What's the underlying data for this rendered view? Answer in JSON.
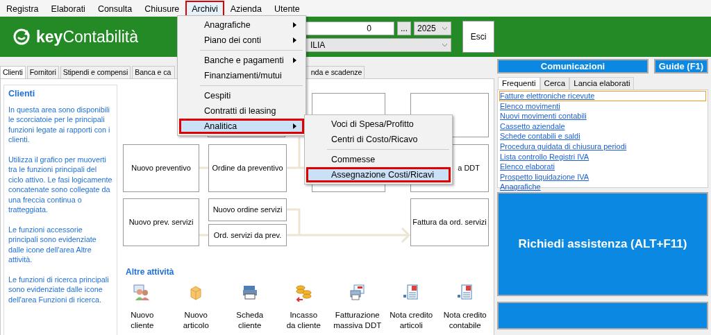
{
  "menubar": [
    {
      "label": "Registra",
      "selected": false,
      "outlined": false
    },
    {
      "label": "Elaborati",
      "selected": false,
      "outlined": false
    },
    {
      "label": "Consulta",
      "selected": false,
      "outlined": false
    },
    {
      "label": "Chiusure",
      "selected": false,
      "outlined": false
    },
    {
      "label": "Archivi",
      "selected": true,
      "outlined": true
    },
    {
      "label": "Azienda",
      "selected": false,
      "outlined": false
    },
    {
      "label": "Utente",
      "selected": false,
      "outlined": false
    }
  ],
  "header": {
    "logo": "**key**Contabilità",
    "company_code": "0",
    "browse_button": "...",
    "year": "2025",
    "company_name": "ILIA",
    "exit_button": "Esci"
  },
  "tabs": [
    {
      "label": "Clienti",
      "selected": true
    },
    {
      "label": "Fornitori",
      "selected": false
    },
    {
      "label": "Stipendi e compensi",
      "selected": false
    },
    {
      "label": "Banca e ca",
      "selected": false
    },
    {
      "label": "nda e scadenze",
      "selected": false
    }
  ],
  "info_panel": {
    "title": "Clienti",
    "paragraphs": [
      "In questa area sono disponibili le scorciatoie per le principali funzioni legate ai rapporti con i clienti.",
      "Utilizza il grafico per muoverti tra le funzioni principali del ciclo attivo. Le fasi logicamente concatenate sono collegate da una freccia continua o tratteggiata.",
      "Le funzioni accessorie principali sono evidenziate dalle icone dell'area Altre attività.",
      "Le funzioni di ricerca principali sono evidenziate dalle icone dell'area Funzioni di ricerca."
    ]
  },
  "diagram": {
    "nodes": [
      {
        "label": "Nuovo preventivo"
      },
      {
        "label": "Ordine da preventivo"
      },
      {
        "label": "a DDT"
      },
      {
        "label": "Nuovo prev. servizi"
      },
      {
        "label": "Nuovo ordine servizi"
      },
      {
        "label": "Ord. servizi da prev."
      },
      {
        "label": "Fattura da ord. servizi"
      }
    ]
  },
  "other_activities": {
    "title": "Altre attività",
    "items": [
      {
        "label": "Nuovo\ncliente"
      },
      {
        "label": "Nuovo\narticolo"
      },
      {
        "label": "Scheda\ncliente"
      },
      {
        "label": "Incasso\nda cliente"
      },
      {
        "label": "Fatturazione\nmassiva DDT"
      },
      {
        "label": "Nota credito\narticoli"
      },
      {
        "label": "Nota credito\ncontabile"
      }
    ]
  },
  "right_panel": {
    "communications_button": "Comunicazioni",
    "guide_button": "Guide (F1)",
    "tabs": [
      {
        "label": "Frequenti",
        "selected": true
      },
      {
        "label": "Cerca",
        "selected": false
      },
      {
        "label": "Lancia elaborati",
        "selected": false
      }
    ],
    "links": [
      {
        "label": "Fatture elettroniche ricevute",
        "focused": true
      },
      {
        "label": "Elenco movimenti",
        "focused": false
      },
      {
        "label": "Nuovi movimenti contabili",
        "focused": false
      },
      {
        "label": "Cassetto aziendale",
        "focused": false
      },
      {
        "label": "Schede contabili e saldi",
        "focused": false
      },
      {
        "label": "Procedura guidata di chiusura periodi",
        "focused": false
      },
      {
        "label": "Lista controllo Registri IVA",
        "focused": false
      },
      {
        "label": "Elenco elaborati",
        "focused": false
      },
      {
        "label": "Prospetto liquidazione IVA",
        "focused": false
      },
      {
        "label": "Anagrafiche",
        "focused": false
      }
    ],
    "assistance_button": "Richiedi assistenza  (ALT+F11)"
  },
  "menu": {
    "items": [
      {
        "kind": "item",
        "label": "Anagrafiche",
        "submenu": true,
        "selected": false,
        "outlined": false
      },
      {
        "kind": "item",
        "label": "Piano dei conti",
        "submenu": true,
        "selected": false,
        "outlined": false
      },
      {
        "kind": "separator"
      },
      {
        "kind": "item",
        "label": "Banche e pagamenti",
        "submenu": true,
        "selected": false,
        "outlined": false
      },
      {
        "kind": "item",
        "label": "Finanziamenti/mutui",
        "submenu": false,
        "selected": false,
        "outlined": false
      },
      {
        "kind": "separator"
      },
      {
        "kind": "item",
        "label": "Cespiti",
        "submenu": false,
        "selected": false,
        "outlined": false
      },
      {
        "kind": "item",
        "label": "Contratti di leasing",
        "submenu": false,
        "selected": false,
        "outlined": false
      },
      {
        "kind": "item",
        "label": "Analitica",
        "submenu": true,
        "selected": true,
        "outlined": true
      }
    ]
  },
  "submenu": {
    "items": [
      {
        "kind": "item",
        "label": "Voci di Spesa/Profitto",
        "submenu": false,
        "selected": false,
        "outlined": false
      },
      {
        "kind": "item",
        "label": "Centri di Costo/Ricavo",
        "submenu": false,
        "selected": false,
        "outlined": false
      },
      {
        "kind": "separator"
      },
      {
        "kind": "item",
        "label": "Commesse",
        "submenu": false,
        "selected": false,
        "outlined": false
      },
      {
        "kind": "item",
        "label": "Assegnazione Costi/Ricavi",
        "submenu": false,
        "selected": true,
        "outlined": true
      }
    ]
  }
}
